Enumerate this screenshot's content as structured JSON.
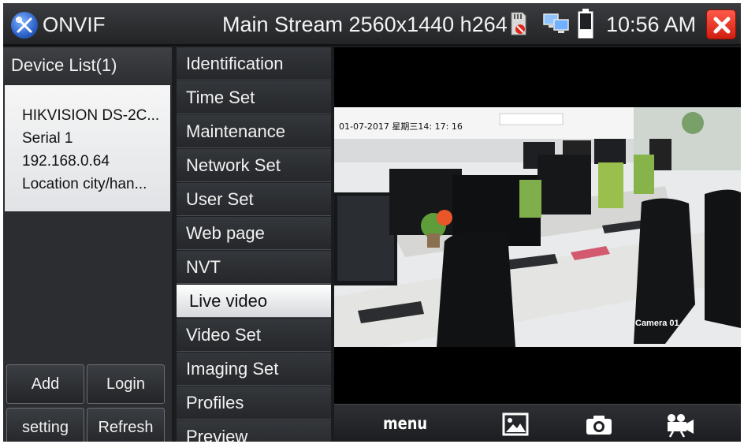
{
  "titlebar": {
    "app_name": "ONVIF",
    "stream_info": "Main Stream 2560x1440 h264",
    "time": "10:56 AM"
  },
  "device_list": {
    "title": "Device List(1)",
    "devices": [
      {
        "name": "HIKVISION DS-2C...",
        "serial": "Serial  1",
        "ip": "192.168.0.64",
        "location": "Location  city/han..."
      }
    ]
  },
  "left_buttons": {
    "add": "Add",
    "login": "Login",
    "setting": "setting",
    "refresh": "Refresh"
  },
  "menu": {
    "items": [
      {
        "label": "Identification"
      },
      {
        "label": "Time Set"
      },
      {
        "label": "Maintenance"
      },
      {
        "label": "Network Set"
      },
      {
        "label": "User Set"
      },
      {
        "label": "Web page"
      },
      {
        "label": "NVT"
      },
      {
        "label": "Live video",
        "active": true
      },
      {
        "label": "Video Set"
      },
      {
        "label": "Imaging Set"
      },
      {
        "label": "Profiles"
      },
      {
        "label": "Preview"
      }
    ]
  },
  "video": {
    "osd_timestamp": "01-07-2017 星期三14: 17: 16",
    "osd_camera": "Camera 01"
  },
  "toolbar": {
    "menu_label": "menu",
    "icons": [
      "image-icon",
      "camera-icon",
      "record-icon"
    ]
  },
  "colors": {
    "active_menu_bg": "#ffffff",
    "close_button": "#e0261a",
    "panel_bg": "#2b2d30"
  }
}
